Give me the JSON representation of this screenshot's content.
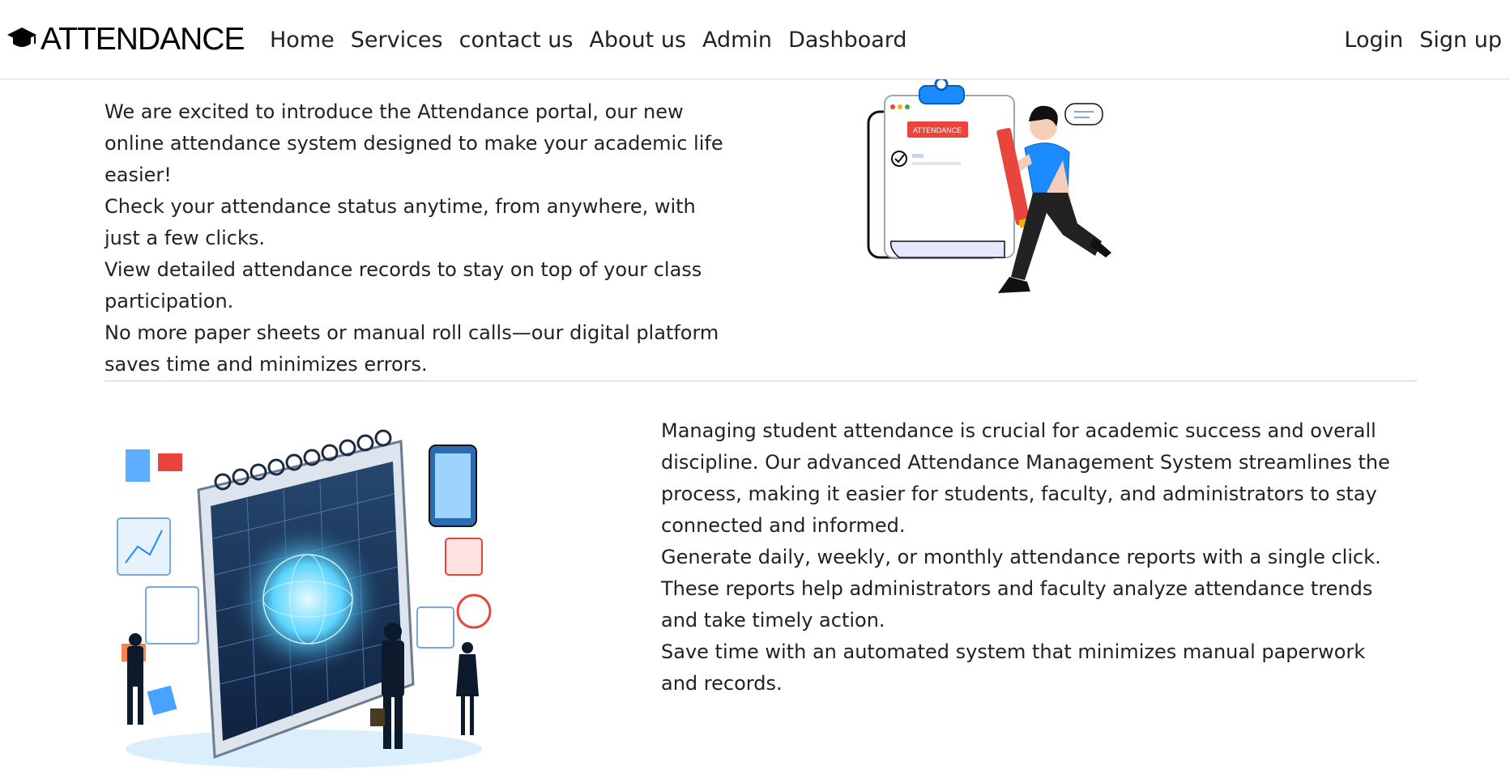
{
  "brand": {
    "name": "ATTENDANCE",
    "icon": "graduation-cap-icon"
  },
  "nav": {
    "links": [
      "Home",
      "Services",
      "contact us",
      "About us",
      "Admin",
      "Dashboard"
    ],
    "right": [
      "Login",
      "Sign up"
    ]
  },
  "section1": {
    "paragraphs": [
      "We are excited to introduce the Attendance portal, our new online attendance system designed to make your academic life easier!",
      "Check your attendance status anytime, from anywhere, with just a few clicks.",
      "View detailed attendance records to stay on top of your class participation.",
      "No more paper sheets or manual roll calls—our digital platform saves time and minimizes errors."
    ],
    "illustration_label": "ATTENDANCE"
  },
  "section2": {
    "paragraphs": [
      "Managing student attendance is crucial for academic success and overall discipline. Our advanced Attendance Management System streamlines the process, making it easier for students, faculty, and administrators to stay connected and informed.",
      "Generate daily, weekly, or monthly attendance reports with a single click. These reports help administrators and faculty analyze attendance trends and take timely action.",
      "Save time with an automated system that minimizes manual paperwork and records."
    ]
  },
  "colors": {
    "accent_blue": "#1a8cff",
    "accent_red": "#e8453c",
    "text": "#222222"
  }
}
